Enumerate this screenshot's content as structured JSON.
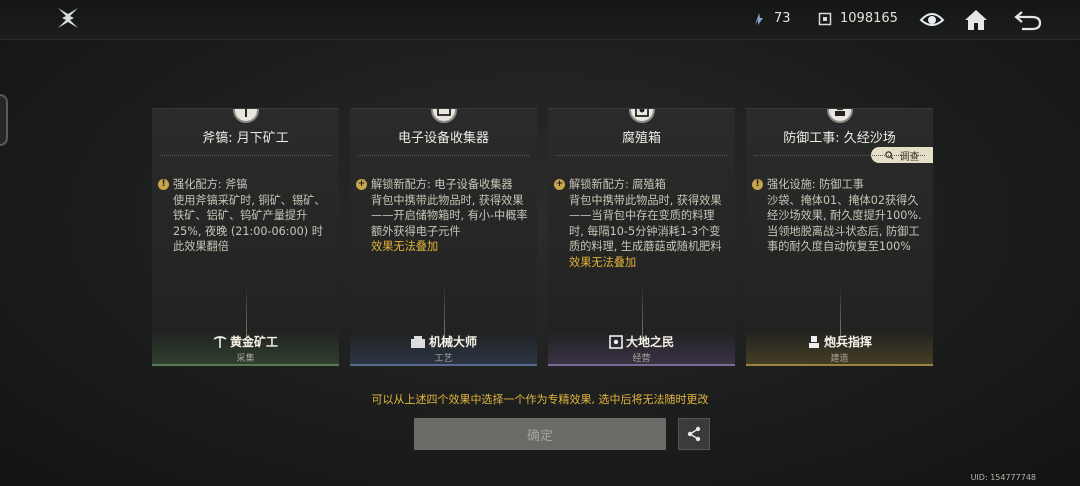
{
  "header": {
    "currency1_value": "73",
    "currency2_value": "1098165",
    "icons": [
      "app-logo-icon",
      "energy-icon",
      "box-icon",
      "eye-icon",
      "home-icon",
      "back-icon"
    ]
  },
  "cards": [
    {
      "title": "斧镐: 月下矿工",
      "inspect_label": "",
      "effect_head": "强化配方: 斧镐",
      "description": "使用斧镐采矿时, 铜矿、锡矿、铁矿、铝矿、钨矿产量提升25%, 夜晚 (21:00-06:00) 时此效果翻倍",
      "note": "",
      "profession": "黄金矿工",
      "category": "采集",
      "icon": "pickaxe-icon"
    },
    {
      "title": "电子设备收集器",
      "inspect_label": "",
      "effect_head": "解锁新配方: 电子设备收集器",
      "description": "背包中携带此物品时, 获得效果——开启储物箱时, 有小-中概率额外获得电子元件",
      "note": "效果无法叠加",
      "profession": "机械大师",
      "category": "工艺",
      "icon": "device-icon"
    },
    {
      "title": "腐殖箱",
      "inspect_label": "",
      "effect_head": "解锁新配方: 腐殖箱",
      "description": "背包中携带此物品时, 获得效果——当背包中存在变质的料理时, 每隔10-5分钟消耗1-3个变质的料理, 生成蘑菇或随机肥料",
      "note": "效果无法叠加",
      "profession": "大地之民",
      "category": "经营",
      "icon": "compost-box-icon"
    },
    {
      "title": "防御工事: 久经沙场",
      "inspect_label": "调查",
      "effect_head": "强化设施: 防御工事",
      "description": "沙袋、掩体01、掩体02获得久经沙场效果, 耐久度提升100%. 当领地脱离战斗状态后, 防御工事的耐久度自动恢复至100%",
      "note": "",
      "profession": "炮兵指挥",
      "category": "建造",
      "icon": "artillery-icon"
    }
  ],
  "hint_text": "可以从上述四个效果中选择一个作为专精效果, 选中后将无法随时更改",
  "confirm_label": "确定",
  "uid_text": "UID: 154777748"
}
